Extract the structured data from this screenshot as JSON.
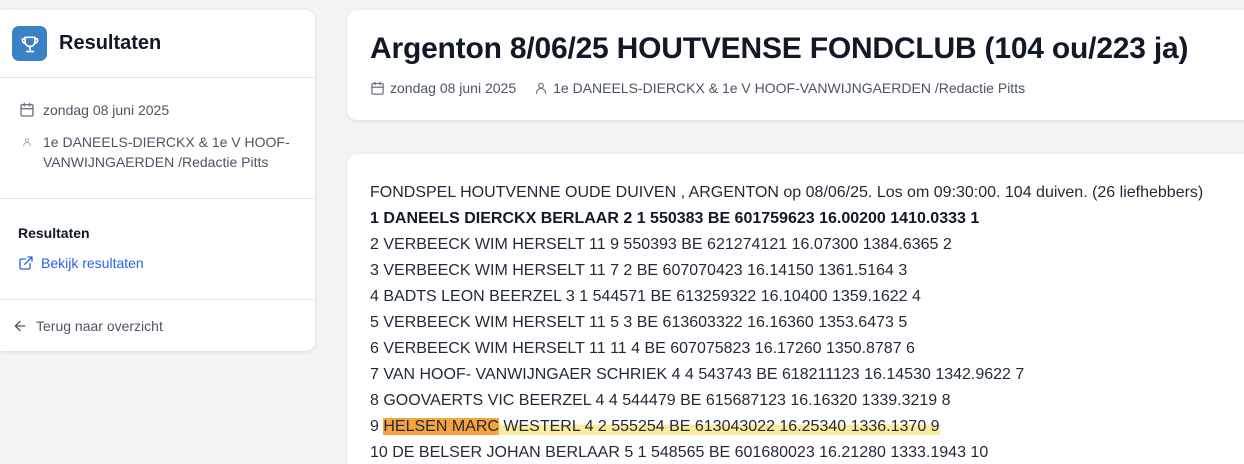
{
  "sidebar": {
    "title": "Resultaten",
    "date": "zondag 08 juni 2025",
    "organizer": "1e DANEELS-DIERCKX & 1e V HOOF-VANWIJNGAERDEN /Redactie Pitts",
    "results_label": "Resultaten",
    "view_results_link": "Bekijk resultaten",
    "back_link": "Terug naar overzicht",
    "accent_color": "#3b82c4"
  },
  "header": {
    "title": "Argenton 8/06/25 HOUTVENSE FONDCLUB (104 ou/223 ja)",
    "date": "zondag 08 juni 2025",
    "organizer": "1e DANEELS-DIERCKX & 1e V HOOF-VANWIJNGAERDEN /Redactie Pitts"
  },
  "content": {
    "intro": "FONDSPEL HOUTVENNE OUDE DUIVEN , ARGENTON op 08/06/25. Los om 09:30:00. 104 duiven. (26 liefhebbers)",
    "lines": [
      "1 DANEELS DIERCKX BERLAAR 2 1 550383 BE 601759623 16.00200 1410.0333 1",
      "2 VERBEECK WIM HERSELT 11 9 550393 BE 621274121 16.07300 1384.6365 2",
      "3 VERBEECK WIM HERSELT 11 7 2 BE 607070423 16.14150 1361.5164 3",
      "4 BADTS LEON BEERZEL 3 1 544571 BE 613259322 16.10400 1359.1622 4",
      "5 VERBEECK WIM HERSELT 11 5 3 BE 613603322 16.16360 1353.6473 5",
      "6 VERBEECK WIM HERSELT 11 11 4 BE 607075823 16.17260 1350.8787 6",
      "7 VAN HOOF- VANWIJNGAER SCHRIEK 4 4 543743 BE 618211123 16.14530 1342.9622 7",
      "8 GOOVAERTS VIC BEERZEL 4 4 544479 BE 615687123 16.16320 1339.3219 8"
    ],
    "highlight_line": {
      "prefix": "9 ",
      "name": "HELSEN MARC",
      "rest": " WESTERL 4 2 555254 BE 613043022 16.25340 1336.1370 9"
    },
    "last_line": "10 DE BELSER JOHAN BERLAAR 5 1 548565 BE 601680023 16.21280 1333.1943 10",
    "highlight_colors": {
      "name": "#f6a43d",
      "rest": "#fce88c"
    }
  },
  "icons": {
    "trophy": "trophy-icon",
    "calendar": "calendar-icon",
    "user": "user-icon",
    "external_link": "external-link-icon",
    "back_arrow": "arrow-left-icon"
  }
}
